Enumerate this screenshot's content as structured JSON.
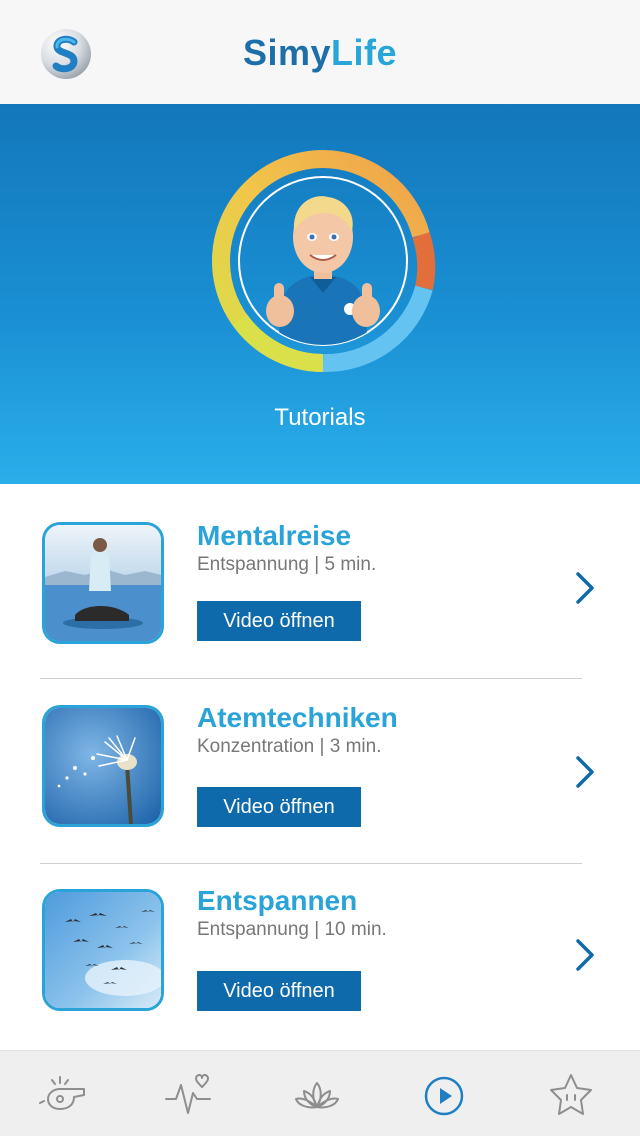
{
  "header": {
    "title_part1": "Simy",
    "title_part2": "Life",
    "logo_icon": "simy-s-logo-icon"
  },
  "hero": {
    "label": "Tutorials",
    "ring_colors": [
      "#f0b84a",
      "#e26f3b",
      "#64c3f0",
      "#d9e04a"
    ]
  },
  "tutorials": [
    {
      "title": "Mentalreise",
      "subtitle": "Entspannung | 5 min.",
      "button": "Video öffnen",
      "image": "meditation-image"
    },
    {
      "title": "Atemtechniken",
      "subtitle": "Konzentration | 3 min.",
      "button": "Video öffnen",
      "image": "dandelion-image"
    },
    {
      "title": "Entspannen",
      "subtitle": "Entspannung | 10 min.",
      "button": "Video öffnen",
      "image": "birds-sky-image"
    }
  ],
  "tabbar": {
    "tabs": [
      {
        "icon": "whistle-icon",
        "active": false
      },
      {
        "icon": "heart-pulse-icon",
        "active": false
      },
      {
        "icon": "lotus-icon",
        "active": false
      },
      {
        "icon": "play-circle-icon",
        "active": true
      },
      {
        "icon": "star-face-icon",
        "active": false
      }
    ],
    "active_color": "#1f7fc2",
    "inactive_color": "#8e8e8e"
  }
}
